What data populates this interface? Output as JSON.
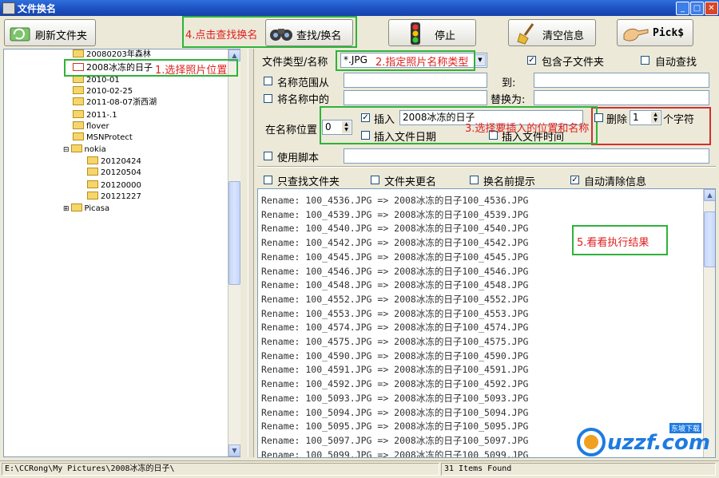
{
  "window": {
    "title": "文件换名"
  },
  "toolbar": {
    "refresh_label": "刷新文件夹",
    "find_replace_label": "查找/换名",
    "stop_label": "停止",
    "clear_label": "清空信息",
    "picks_label": "Pick$"
  },
  "annotations": {
    "step1": "1.选择照片位置",
    "step2": "2.指定照片名称类型",
    "step3": "3.选择要插入的位置和名称",
    "step4": "4.点击查找换名",
    "step5": "5.看看执行结果"
  },
  "tree": {
    "items": [
      {
        "label": "20080203年森林"
      },
      {
        "label": "2008冰冻的日子"
      },
      {
        "label": "2010-01"
      },
      {
        "label": "2010-02-25"
      },
      {
        "label": "2011-08-07浙西湖"
      },
      {
        "label": "2011-.1"
      },
      {
        "label": "flover"
      },
      {
        "label": "MSNProtect"
      },
      {
        "label": "nokia"
      },
      {
        "label": "20120424"
      },
      {
        "label": "20120504"
      },
      {
        "label": "20120000"
      },
      {
        "label": "20121227"
      },
      {
        "label": "Picasa"
      }
    ]
  },
  "form": {
    "file_type_label": "文件类型/名称",
    "file_type_value": "*.JPG",
    "include_subfolders_label": "包含子文件夹",
    "include_subfolders_checked": true,
    "auto_find_label": "自动查找",
    "auto_find_checked": false,
    "name_range_label": "名称范围从",
    "to_label": "到:",
    "replace_label": "将名称中的",
    "replace_with_label": "替换为:",
    "position_label": "在名称位置",
    "position_value": "0",
    "insert_label": "插入",
    "insert_checked": true,
    "insert_value": "2008冰冻的日子",
    "insert_date_label": "插入文件日期",
    "insert_time_label": "插入文件时间",
    "delete_label": "删除",
    "delete_value": "1",
    "chars_label": "个字符",
    "script_label": "使用脚本",
    "only_folders_label": "只查找文件夹",
    "folder_rename_label": "文件夹更名",
    "prompt_label": "换名前提示",
    "auto_clear_label": "自动清除信息",
    "auto_clear_checked": true
  },
  "log": {
    "lines": [
      "Rename: 100_4536.JPG => 2008冰冻的日子100_4536.JPG",
      "Rename: 100_4539.JPG => 2008冰冻的日子100_4539.JPG",
      "Rename: 100_4540.JPG => 2008冰冻的日子100_4540.JPG",
      "Rename: 100_4542.JPG => 2008冰冻的日子100_4542.JPG",
      "Rename: 100_4545.JPG => 2008冰冻的日子100_4545.JPG",
      "Rename: 100_4546.JPG => 2008冰冻的日子100_4546.JPG",
      "Rename: 100_4548.JPG => 2008冰冻的日子100_4548.JPG",
      "Rename: 100_4552.JPG => 2008冰冻的日子100_4552.JPG",
      "Rename: 100_4553.JPG => 2008冰冻的日子100_4553.JPG",
      "Rename: 100_4574.JPG => 2008冰冻的日子100_4574.JPG",
      "Rename: 100_4575.JPG => 2008冰冻的日子100_4575.JPG",
      "Rename: 100_4590.JPG => 2008冰冻的日子100_4590.JPG",
      "Rename: 100_4591.JPG => 2008冰冻的日子100_4591.JPG",
      "Rename: 100_4592.JPG => 2008冰冻的日子100_4592.JPG",
      "Rename: 100_5093.JPG => 2008冰冻的日子100_5093.JPG",
      "Rename: 100_5094.JPG => 2008冰冻的日子100_5094.JPG",
      "Rename: 100_5095.JPG => 2008冰冻的日子100_5095.JPG",
      "Rename: 100_5097.JPG => 2008冰冻的日子100_5097.JPG",
      "Rename: 100_5099.JPG => 2008冰冻的日子100_5099.JPG"
    ]
  },
  "status": {
    "path": "E:\\CCRong\\My Pictures\\2008冰冻的日子\\",
    "count": "31 Items Found"
  },
  "watermark": {
    "text": "uzzf.com",
    "subtitle": "东坡下载"
  },
  "colors": {
    "callout": "#2fb33a",
    "annotation_text": "#e02020",
    "titlebar": "#1b4fc0"
  }
}
